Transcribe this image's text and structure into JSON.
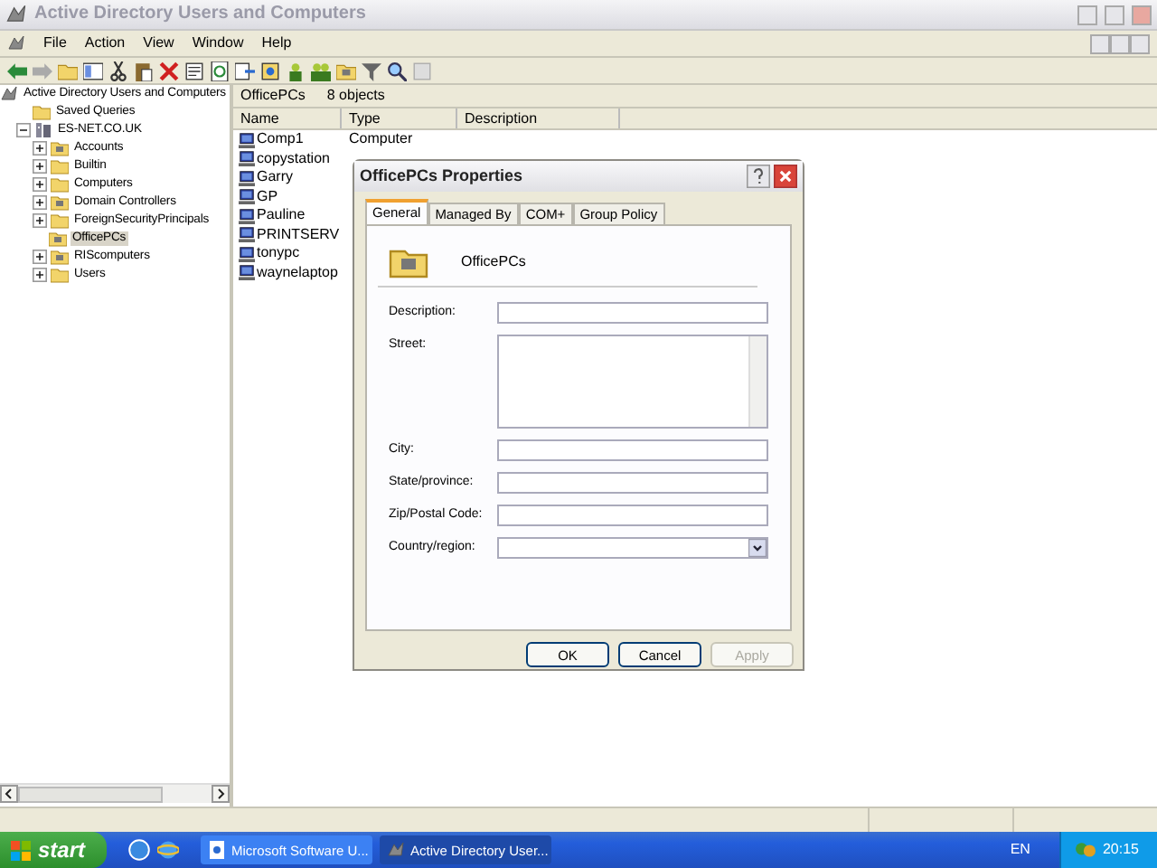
{
  "window": {
    "title": "Active Directory Users and Computers"
  },
  "menu": [
    "File",
    "Action",
    "View",
    "Window",
    "Help"
  ],
  "tree": [
    {
      "label": "Active Directory Users and Computers",
      "kind": "root",
      "selected": false,
      "children": [
        {
          "label": "Saved Queries",
          "kind": "folder",
          "selected": false
        },
        {
          "label": "ES-NET.CO.UK",
          "kind": "domain",
          "selected": false,
          "expanded": true,
          "children": [
            {
              "label": "Accounts",
              "kind": "ou",
              "selected": false,
              "expanded": false
            },
            {
              "label": "Builtin",
              "kind": "folder",
              "selected": false,
              "expanded": false
            },
            {
              "label": "Computers",
              "kind": "folder",
              "selected": false,
              "expanded": false
            },
            {
              "label": "Domain Controllers",
              "kind": "ou",
              "selected": false,
              "expanded": false
            },
            {
              "label": "ForeignSecurityPrincipals",
              "kind": "folder",
              "selected": false,
              "expanded": false
            },
            {
              "label": "OfficePCs",
              "kind": "ou",
              "selected": true
            },
            {
              "label": "RIScomputers",
              "kind": "ou",
              "selected": false,
              "expanded": false
            },
            {
              "label": "Users",
              "kind": "folder",
              "selected": false,
              "expanded": false
            }
          ]
        }
      ]
    }
  ],
  "list": {
    "path": "OfficePCs",
    "count": "8 objects",
    "columns": [
      "Name",
      "Type",
      "Description"
    ],
    "rows": [
      {
        "name": "Comp1",
        "type": "Computer"
      },
      {
        "name": "copystation"
      },
      {
        "name": "Garry"
      },
      {
        "name": "GP"
      },
      {
        "name": "Pauline"
      },
      {
        "name": "PRINTSERV"
      },
      {
        "name": "tonypc"
      },
      {
        "name": "waynelaptop"
      }
    ]
  },
  "dialog": {
    "title": "OfficePCs Properties",
    "object_name": "OfficePCs",
    "tabs": [
      {
        "label": "General",
        "selected": true
      },
      {
        "label": "Managed By",
        "selected": false
      },
      {
        "label": "COM+",
        "selected": false
      },
      {
        "label": "Group Policy",
        "selected": false
      }
    ],
    "fields": [
      {
        "kind": "text",
        "label": "Description:"
      },
      {
        "kind": "multiline",
        "label": "Street:"
      },
      {
        "kind": "text",
        "label": "City:"
      },
      {
        "kind": "text",
        "label": "State/province:"
      },
      {
        "kind": "text",
        "label": "Zip/Postal Code:"
      },
      {
        "kind": "dropdown",
        "label": "Country/region:"
      }
    ],
    "buttons": [
      {
        "label": "OK",
        "disabled": false
      },
      {
        "label": "Cancel",
        "disabled": false
      },
      {
        "label": "Apply",
        "disabled": true
      }
    ]
  },
  "taskbar": {
    "start": "start",
    "tasks": [
      {
        "label": "Microsoft Software U...",
        "selected": false
      },
      {
        "label": "Active Directory User...",
        "selected": true
      }
    ],
    "language": "EN",
    "clock": "20:15"
  }
}
